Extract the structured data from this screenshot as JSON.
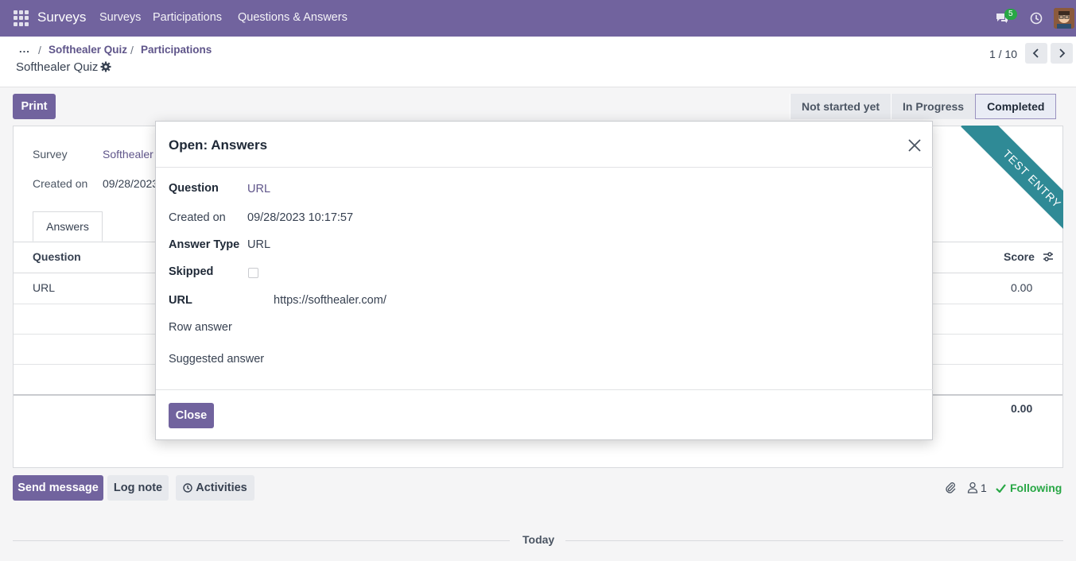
{
  "navbar": {
    "brand": "Surveys",
    "menu": [
      "Surveys",
      "Participations",
      "Questions & Answers"
    ],
    "messages_badge": "5",
    "accent_color": "#71639e"
  },
  "breadcrumb": {
    "dots": "...",
    "items": [
      "Softhealer Quiz",
      "Participations"
    ],
    "current": "Softhealer Quiz"
  },
  "pager": {
    "value": "1 / 10"
  },
  "form": {
    "print_label": "Print",
    "stages": [
      "Not started yet",
      "In Progress",
      "Completed"
    ],
    "active_stage": "Completed",
    "ribbon": "TEST ENTRY",
    "fields": [
      {
        "label": "Survey",
        "value": "Softhealer"
      },
      {
        "label": "Created on",
        "value": "09/28/2023"
      }
    ],
    "tab": "Answers",
    "table": {
      "headers": {
        "question": "Question",
        "score": "Score"
      },
      "rows": [
        {
          "question": "URL",
          "score": "0.00"
        }
      ],
      "total": "0.00"
    }
  },
  "chatter": {
    "send_message": "Send message",
    "log_note": "Log note",
    "activities": "Activities",
    "followers_count": "1",
    "following": "Following",
    "today": "Today"
  },
  "modal": {
    "title": "Open: Answers",
    "question_label": "Question",
    "question_value": "URL",
    "created_label": "Created on",
    "created_value": "09/28/2023 10:17:57",
    "answer_type_label": "Answer Type",
    "answer_type_value": "URL",
    "skipped_label": "Skipped",
    "url_label": "URL",
    "url_value": "https://softhealer.com/",
    "row_answer_label": "Row answer",
    "suggested_answer_label": "Suggested answer",
    "close_label": "Close"
  }
}
